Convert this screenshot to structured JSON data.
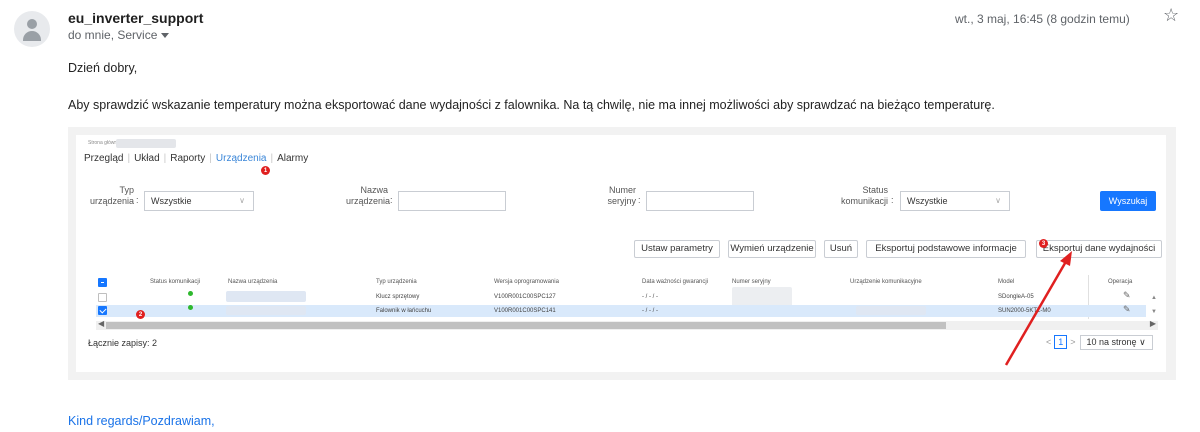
{
  "email": {
    "sender": "eu_inverter_support",
    "recipients": "do mnie, Service",
    "date": "wt., 3 maj, 16:45 (8 godzin temu)",
    "greeting": "Dzień dobry,",
    "body": "Aby sprawdzić wskazanie temperatury można eksportować dane wydajności z falownika. Na tą chwilę, nie ma innej możliwości aby sprawdzać na bieżąco temperaturę.",
    "signoff": "Kind regards/Pozdrawiam,"
  },
  "screenshot": {
    "breadcrumb": "Strona główna  >",
    "nav": [
      "Przegląd",
      "Układ",
      "Raporty",
      "Urządzenia",
      "Alarmy"
    ],
    "badges": [
      "1",
      "2",
      "3"
    ],
    "filters": {
      "type_label": "Typ urządzenia",
      "type_value": "Wszystkie",
      "name_label": "Nazwa urządzenia",
      "serial_label": "Numer seryjny",
      "status_label": "Status komunikacji",
      "status_value": "Wszystkie",
      "search_button": "Wyszukaj"
    },
    "toolbar": [
      "Ustaw parametry",
      "Wymień urządzenie",
      "Usuń",
      "Eksportuj podstawowe informacje",
      "Eksportuj dane wydajności"
    ],
    "columns": [
      "Status komunikacji",
      "Nazwa urządzenia",
      "Typ urządzenia",
      "Wersja oprogramowania",
      "Data ważności gwarancji",
      "Numer seryjny",
      "Urządzenie komunikacyjne",
      "Model",
      "Operacja"
    ],
    "rows": [
      {
        "type": "Klucz sprzętowy",
        "version": "V100R001C00SPC127",
        "warranty": "- / - / -",
        "model": "SDongleA-05",
        "checked": false
      },
      {
        "type": "Falownik w łańcuchu",
        "version": "V100R001C00SPC141",
        "warranty": "- / - / -",
        "model": "SUN2000-5KTL-M0",
        "checked": true
      }
    ],
    "total": "Łącznie zapisy: 2",
    "page": "1",
    "per_page": "10 na stronę",
    "status_color": "#2eb82e",
    "accent_color": "#1677ff",
    "badge_color": "#e02020"
  }
}
